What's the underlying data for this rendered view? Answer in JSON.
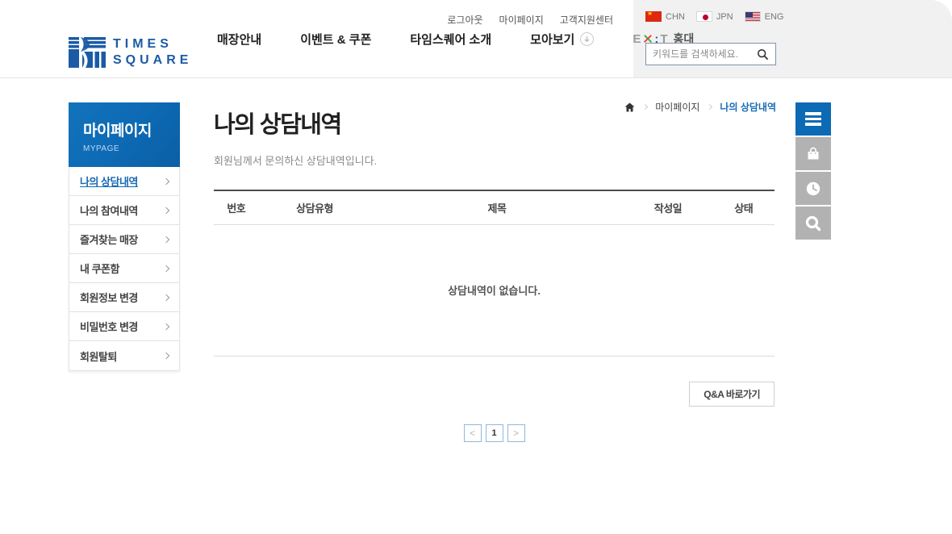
{
  "header": {
    "utility_links": [
      {
        "label": "로그아웃"
      },
      {
        "label": "마이페이지"
      },
      {
        "label": "고객지원센터"
      }
    ],
    "languages": [
      {
        "code": "CHN",
        "flag_icon": "china-flag-icon"
      },
      {
        "code": "JPN",
        "flag_icon": "japan-flag-icon"
      },
      {
        "code": "ENG",
        "flag_icon": "usa-flag-icon"
      }
    ],
    "logo": {
      "line1": "TIMES",
      "line2": "SQUARE"
    },
    "nav": [
      {
        "label": "매장안내"
      },
      {
        "label": "이벤트 & 쿠폰"
      },
      {
        "label": "타임스퀘어 소개"
      },
      {
        "label": "모아보기",
        "icon": "arrow-down-circle-icon"
      }
    ],
    "exit_logo": {
      "e": "E",
      "colon": ":",
      "t": "T",
      "suffix": "홍대"
    },
    "search": {
      "placeholder": "키워드를 검색하세요.",
      "icon": "search-icon"
    }
  },
  "sidebar": {
    "title": "마이페이지",
    "subtitle": "MYPAGE",
    "items": [
      {
        "label": "나의 상담내역",
        "active": true
      },
      {
        "label": "나의 참여내역",
        "active": false
      },
      {
        "label": "즐겨찾는 매장",
        "active": false
      },
      {
        "label": "내 쿠폰함",
        "active": false
      },
      {
        "label": "회원정보 변경",
        "active": false
      },
      {
        "label": "비밀번호 변경",
        "active": false
      },
      {
        "label": "회원탈퇴",
        "active": false
      }
    ]
  },
  "breadcrumb": {
    "home_icon": "home-icon",
    "items": [
      {
        "label": "마이페이지",
        "current": false
      },
      {
        "label": "나의 상담내역",
        "current": true
      }
    ]
  },
  "main": {
    "title": "나의 상담내역",
    "description": "회원님께서 문의하신 상담내역입니다.",
    "table": {
      "columns": [
        "번호",
        "상담유형",
        "제목",
        "작성일",
        "상태"
      ],
      "rows": [],
      "empty_message": "상담내역이 없습니다."
    },
    "qna_button_label": "Q&A 바로가기",
    "pagination": {
      "prev": "<",
      "pages": [
        "1"
      ],
      "current_page": "1",
      "next": ">"
    }
  },
  "floating_menu": {
    "buttons": [
      {
        "icon": "menu-icon",
        "color": "#0d6ab4"
      },
      {
        "icon": "shopping-bag-icon",
        "color": "#b2b2b2"
      },
      {
        "icon": "clock-icon",
        "color": "#b2b2b2"
      },
      {
        "icon": "search-icon",
        "color": "#b2b2b2"
      }
    ]
  },
  "colors": {
    "primary_blue": "#0d6ab4",
    "logo_blue": "#1b5ba6",
    "active_link_blue": "#1569b3",
    "breadcrumb_active_blue": "#1a6cb5",
    "gray_button": "#b2b2b2",
    "header_panel_gray": "#f1f1f2",
    "table_top_border": "#4d4d4d",
    "pagination_border": "#8fb8dc",
    "exit_x_green": "#2eb44d",
    "exit_x_red": "#e94537",
    "china_flag_red": "#de2910",
    "japan_flag_red": "#bc002d"
  }
}
